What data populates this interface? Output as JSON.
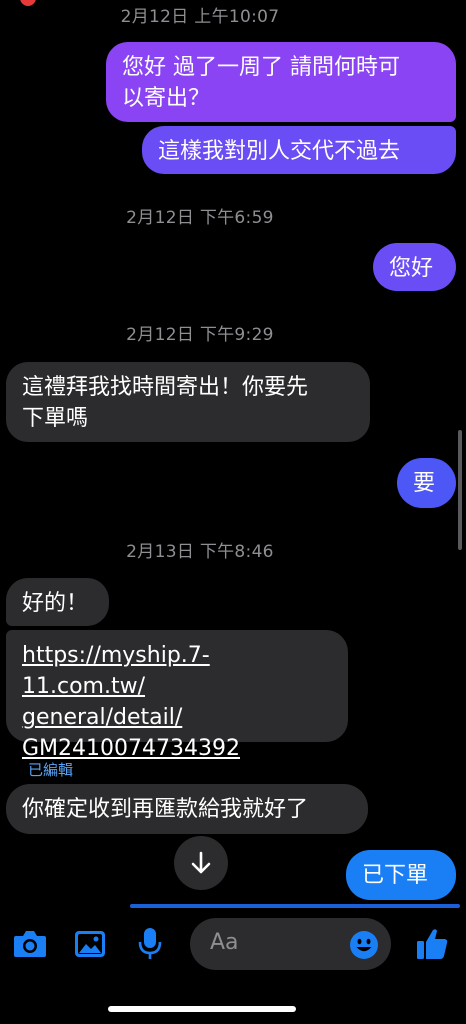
{
  "conversation": {
    "timestamps": {
      "t0": "2月12日 上午10:07",
      "t1": "2月12日 下午6:59",
      "t2": "2月12日 下午9:29",
      "t3": "2月13日 下午8:46"
    },
    "messages": [
      {
        "side": "outgoing",
        "text": "您好 過了一周了 請問何時可\n以寄出？"
      },
      {
        "side": "outgoing",
        "text": "這樣我對別人交代不過去"
      },
      {
        "side": "outgoing",
        "text": "您好"
      },
      {
        "side": "incoming",
        "text": "這禮拜我找時間寄出！你要先\n下單嗎"
      },
      {
        "side": "outgoing",
        "text": "要"
      },
      {
        "side": "incoming",
        "text": "好的！"
      },
      {
        "side": "incoming",
        "text": "https://myship.7-11.com.tw/\ngeneral/detail/\nGM2410074734392",
        "is_link": true
      },
      {
        "side": "incoming",
        "text": "你確定收到再匯款給我就好了",
        "edited_label": "已編輯"
      },
      {
        "side": "outgoing",
        "text": "已下單"
      }
    ]
  },
  "composer": {
    "placeholder": "Aa",
    "icons": [
      "camera-icon",
      "image-icon",
      "microphone-icon",
      "emoji-icon",
      "thumbs-up-icon"
    ]
  },
  "colors": {
    "outgoing_gradient": [
      "#8a44f3",
      "#6a4df5",
      "#4c57f5",
      "#1a7ff5"
    ],
    "incoming": "#2c2c2e",
    "accent": "#1a7ff5",
    "edited_label": "#5aa3f4"
  }
}
